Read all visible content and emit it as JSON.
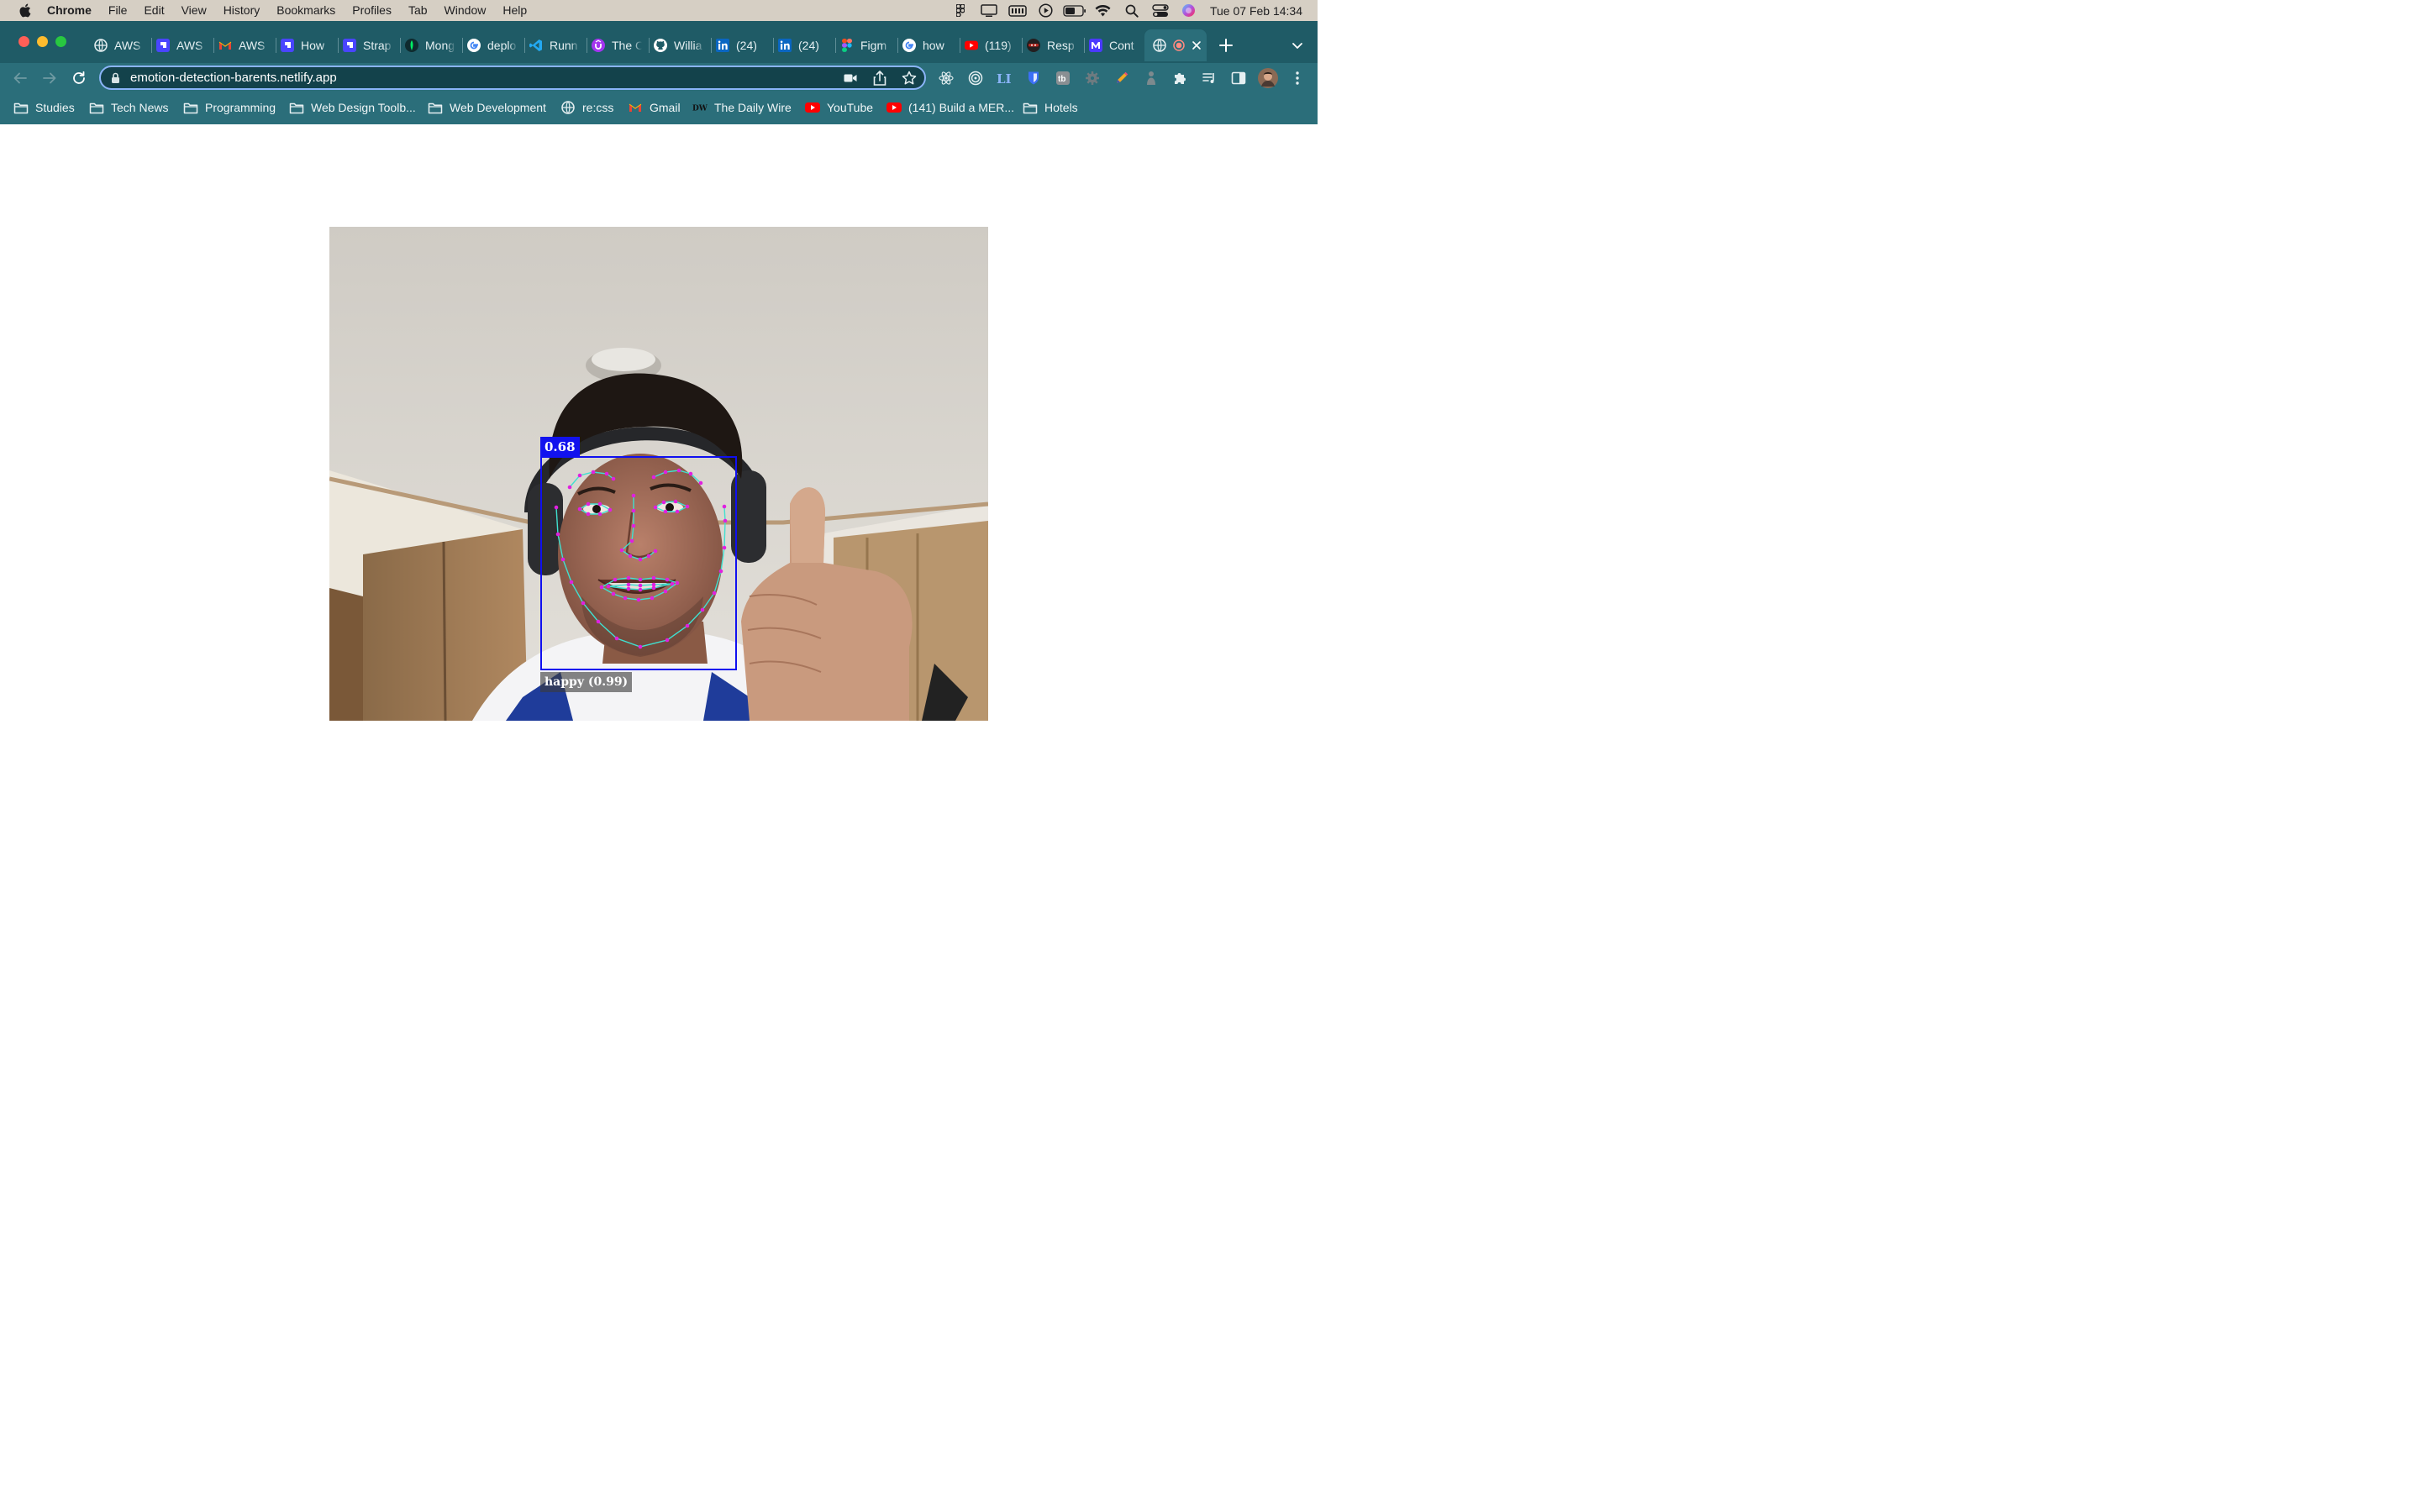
{
  "menubar": {
    "app": "Chrome",
    "items": [
      "File",
      "Edit",
      "View",
      "History",
      "Bookmarks",
      "Profiles",
      "Tab",
      "Window",
      "Help"
    ],
    "clock": "Tue 07 Feb  14:34",
    "status_icons": [
      "figma-icon",
      "display-icon",
      "battery-monitor-icon",
      "play-icon",
      "battery-icon",
      "wifi-icon",
      "spotlight-search-icon",
      "control-center-icon",
      "siri-icon"
    ]
  },
  "tabs": [
    {
      "title": "AWS",
      "icon": "globe-icon",
      "color": "#e6f0f2"
    },
    {
      "title": "AWS",
      "icon": "strapi-icon",
      "color": "#4945ff"
    },
    {
      "title": "AWS",
      "icon": "gmail-icon",
      "color": "#ea4335"
    },
    {
      "title": "How",
      "icon": "strapi-icon",
      "color": "#4945ff"
    },
    {
      "title": "Strap",
      "icon": "strapi-icon",
      "color": "#4945ff"
    },
    {
      "title": "Mong",
      "icon": "mongodb-icon",
      "color": "#00ed64"
    },
    {
      "title": "deplo",
      "icon": "google-icon",
      "color": "#ffffff"
    },
    {
      "title": "Runn",
      "icon": "vscode-icon",
      "color": "#23a9f2"
    },
    {
      "title": "The C",
      "icon": "udemy-icon",
      "color": "#a435f0"
    },
    {
      "title": "Willia",
      "icon": "github-icon",
      "color": "#ffffff"
    },
    {
      "title": "(24)",
      "icon": "linkedin-icon",
      "color": "#0a66c2"
    },
    {
      "title": "(24)",
      "icon": "linkedin-icon",
      "color": "#0a66c2"
    },
    {
      "title": "Figm",
      "icon": "figma-icon",
      "color": "#f24e1e"
    },
    {
      "title": "how",
      "icon": "google-icon",
      "color": "#ffffff"
    },
    {
      "title": "(119)",
      "icon": "youtube-icon",
      "color": "#ff0000"
    },
    {
      "title": "Resp",
      "icon": "ninja-icon",
      "color": "#b3261e"
    },
    {
      "title": "Cont",
      "icon": "medium-m-icon",
      "color": "#4a3aff"
    }
  ],
  "address_bar": {
    "url": "emotion-detection-barents.netlify.app"
  },
  "bookmarks": [
    {
      "label": "Studies",
      "icon": "folder-icon"
    },
    {
      "label": "Tech News",
      "icon": "folder-icon"
    },
    {
      "label": "Programming",
      "icon": "folder-icon"
    },
    {
      "label": "Web Design Toolb...",
      "icon": "folder-icon"
    },
    {
      "label": "Web Development",
      "icon": "folder-icon"
    },
    {
      "label": "re:css",
      "icon": "globe-icon"
    },
    {
      "label": "Gmail",
      "icon": "gmail-icon"
    },
    {
      "label": "The Daily Wire",
      "icon": "dailywire-icon"
    },
    {
      "label": "YouTube",
      "icon": "youtube-icon"
    },
    {
      "label": "(141) Build a MER...",
      "icon": "youtube-icon"
    },
    {
      "label": "Hotels",
      "icon": "folder-icon"
    }
  ],
  "detection": {
    "score": "0.68",
    "emotion": "happy (0.99)",
    "box_color": "#1010f0",
    "landmark_color": "#e020e0",
    "contour_color": "#40e0d0"
  }
}
